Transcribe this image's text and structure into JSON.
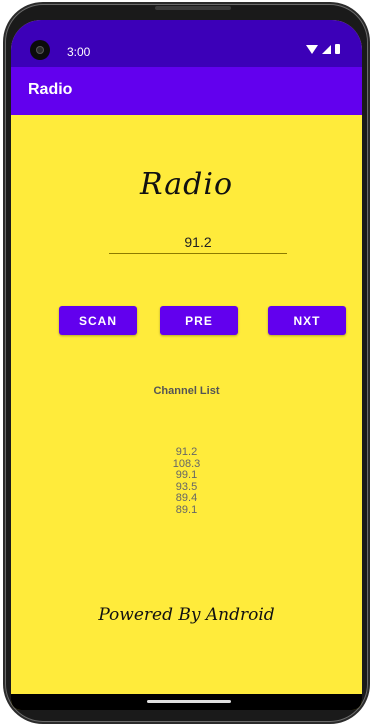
{
  "status": {
    "time": "3:00"
  },
  "appbar": {
    "title": "Radio"
  },
  "main": {
    "heading": "Radio",
    "frequency_value": "91.2",
    "buttons": {
      "scan": "SCAN",
      "pre": "PRE",
      "nxt": "NXT"
    },
    "channel_list_title": "Channel List",
    "channels": [
      "91.2",
      "108.3",
      "99.1",
      "93.5",
      "89.4",
      "89.1"
    ],
    "footer": "Powered By Android"
  },
  "colors": {
    "status_bar": "#3c00b8",
    "app_bar": "#6200ee",
    "background": "#ffeb3b",
    "button": "#6200ee"
  },
  "icons": [
    "camera-icon",
    "wifi-icon",
    "signal-icon",
    "battery-icon"
  ]
}
